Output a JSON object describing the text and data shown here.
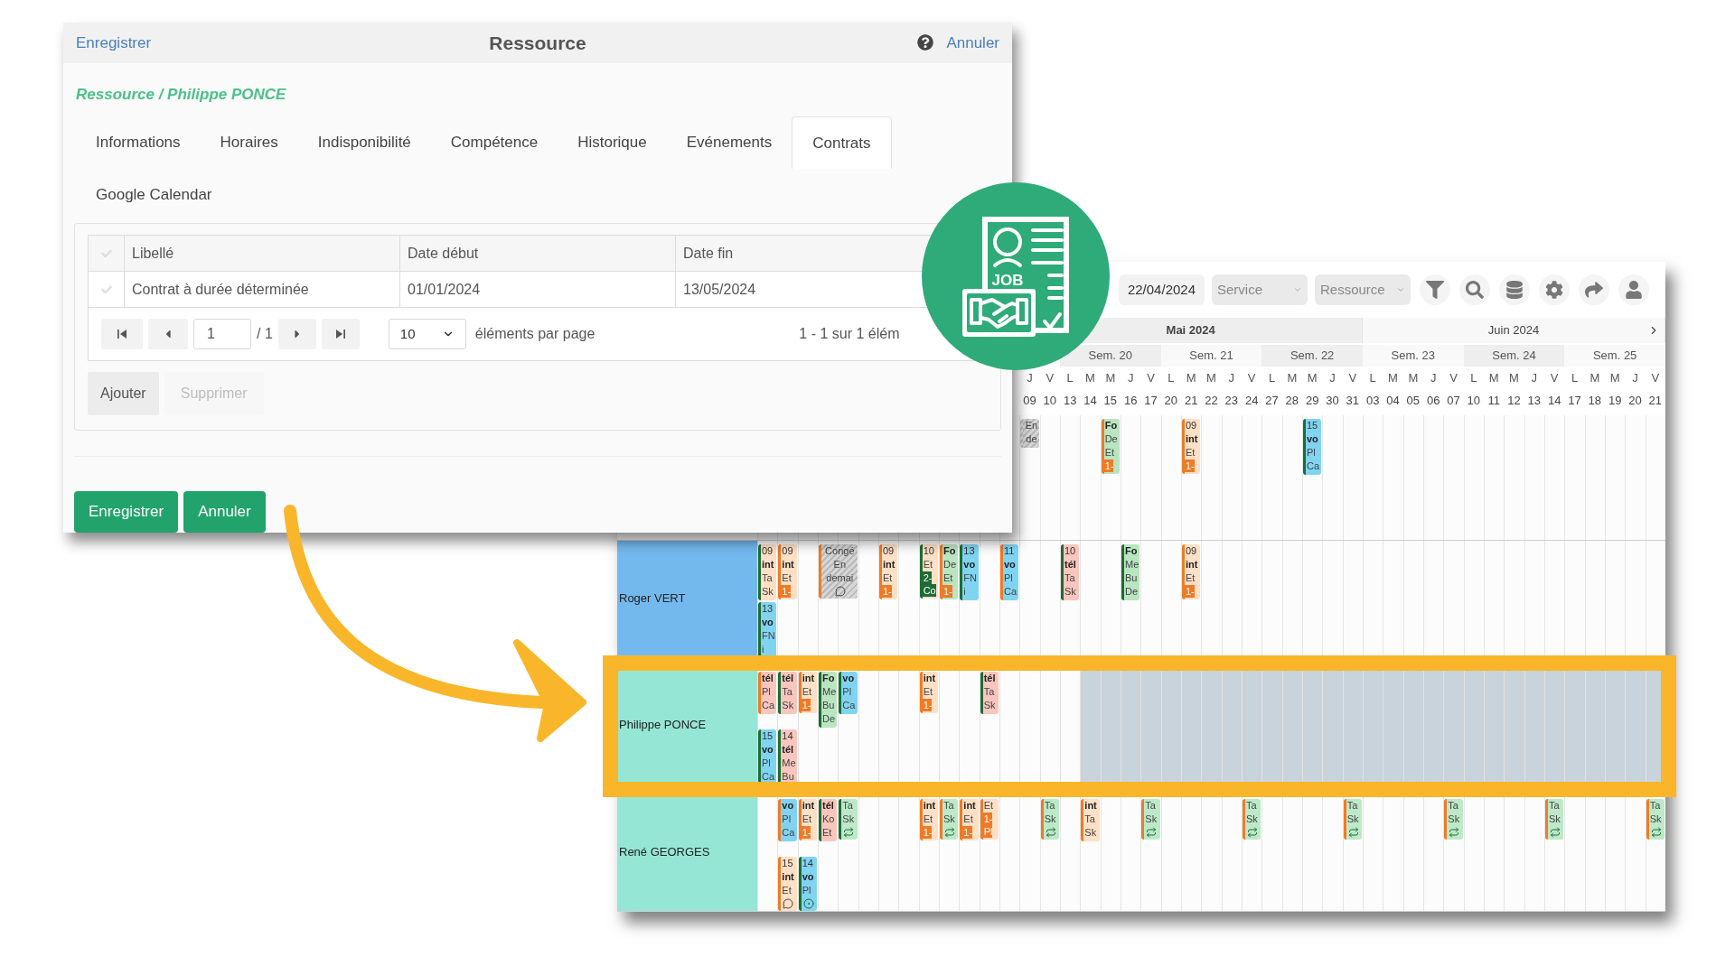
{
  "dialog": {
    "header_save": "Enregistrer",
    "title": "Ressource",
    "header_cancel": "Annuler",
    "breadcrumb": "Ressource / Philippe PONCE",
    "tabs": [
      {
        "label": "Informations",
        "selected": false
      },
      {
        "label": "Horaires",
        "selected": false
      },
      {
        "label": "Indisponibilité",
        "selected": false
      },
      {
        "label": "Compétence",
        "selected": false
      },
      {
        "label": "Historique",
        "selected": false
      },
      {
        "label": "Evénements",
        "selected": false
      },
      {
        "label": "Contrats",
        "selected": true
      },
      {
        "label": "Google Calendar",
        "selected": false
      }
    ],
    "table": {
      "columns": [
        "Libellé",
        "Date début",
        "Date fin"
      ],
      "rows": [
        [
          "Contrat à durée déterminée",
          "01/01/2024",
          "13/05/2024"
        ]
      ]
    },
    "pager": {
      "page": "1",
      "of": "/ 1",
      "per_page": "10",
      "per_page_label": "éléments par page",
      "summary": "1 - 1 sur 1 élém"
    },
    "actions": [
      {
        "label": "Ajouter",
        "disabled": false
      },
      {
        "label": "Supprimer",
        "disabled": true
      }
    ],
    "footer_buttons": [
      "Enregistrer",
      "Annuler"
    ]
  },
  "badge": {
    "label": "JOB"
  },
  "scheduler": {
    "date": "22/04/2024",
    "filters": [
      {
        "placeholder": "Service"
      },
      {
        "placeholder": "Ressource"
      }
    ],
    "months": [
      {
        "label": "Mai 2024",
        "weeks": [
          {
            "days": [
              {
                "letter": "J",
                "number": "09"
              },
              {
                "letter": "V",
                "number": "10"
              }
            ]
          },
          {
            "label": "Sem. 20",
            "days": [
              {
                "letter": "L",
                "number": "13"
              },
              {
                "letter": "M",
                "number": "14"
              },
              {
                "letter": "M",
                "number": "15"
              },
              {
                "letter": "J",
                "number": "16"
              },
              {
                "letter": "V",
                "number": "17"
              }
            ]
          },
          {
            "label": "Sem. 21",
            "days": [
              {
                "letter": "L",
                "number": "20"
              },
              {
                "letter": "M",
                "number": "21"
              },
              {
                "letter": "M",
                "number": "22"
              },
              {
                "letter": "J",
                "number": "23"
              },
              {
                "letter": "V",
                "number": "24"
              }
            ]
          },
          {
            "label": "Sem. 22",
            "days": [
              {
                "letter": "L",
                "number": "27"
              },
              {
                "letter": "M",
                "number": "28"
              },
              {
                "letter": "M",
                "number": "29"
              },
              {
                "letter": "J",
                "number": "30"
              },
              {
                "letter": "V",
                "number": "31"
              }
            ]
          }
        ]
      },
      {
        "label": "Juin 2024",
        "weeks": [
          {
            "label": "Sem. 23",
            "days": [
              {
                "letter": "L",
                "number": "03"
              },
              {
                "letter": "M",
                "number": "04"
              },
              {
                "letter": "M",
                "number": "05"
              },
              {
                "letter": "J",
                "number": "06"
              },
              {
                "letter": "V",
                "number": "07"
              }
            ]
          },
          {
            "label": "Sem. 24",
            "days": [
              {
                "letter": "L",
                "number": "10"
              },
              {
                "letter": "M",
                "number": "11"
              },
              {
                "letter": "M",
                "number": "12"
              },
              {
                "letter": "J",
                "number": "13"
              },
              {
                "letter": "V",
                "number": "14"
              }
            ]
          },
          {
            "label": "Sem. 25",
            "days": [
              {
                "letter": "L",
                "number": "17"
              },
              {
                "letter": "M",
                "number": "18"
              },
              {
                "letter": "M",
                "number": "19"
              },
              {
                "letter": "J",
                "number": "20"
              },
              {
                "letter": "V",
                "number": "21"
              }
            ]
          }
        ]
      }
    ],
    "rows": [
      {
        "highlighted": false,
        "cells": [
          null,
          null,
          null,
          null,
          null,
          null,
          null,
          null,
          null,
          null,
          null,
          null,
          null,
          [
            {
              "kind": "leave",
              "lines": [
                "En",
                "de"
              ]
            }
          ],
          null,
          null,
          null,
          [
            {
              "kind": "formation",
              "color": "#f07a26",
              "title": "Fo",
              "lines": [
                "De",
                "Et"
              ],
              "tags": [
                "1-"
              ]
            }
          ],
          null,
          null,
          null,
          [
            {
              "kind": "intervention",
              "color": "#f07a26",
              "time": "09",
              "title": "int",
              "lines": [
                "Et"
              ],
              "tags": [
                "1-"
              ]
            }
          ],
          null,
          null,
          null,
          null,
          null,
          [
            {
              "kind": "visio",
              "color": "#1f6b35",
              "time": "15",
              "title": "vo",
              "lines": [
                "Pl",
                "Ca"
              ]
            }
          ],
          null,
          null,
          null,
          null,
          null,
          null,
          null,
          null,
          null,
          null,
          null,
          null,
          null,
          null,
          null,
          null,
          null
        ]
      },
      {
        "name": "Roger VERT",
        "color": "#74b9ee",
        "highlighted": false,
        "cells": [
          [
            {
              "kind": "intervention",
              "color": "#1f6b35",
              "time": "09",
              "title": "int",
              "lines": [
                "Ta",
                "Sk"
              ]
            },
            {
              "kind": "visio",
              "color": "#1f6b35",
              "time": "13",
              "title": "vo",
              "lines": [
                "FN",
                "i"
              ]
            }
          ],
          [
            {
              "kind": "intervention",
              "color": "#f07a26",
              "time": "09",
              "title": "int",
              "lines": [
                "Et"
              ],
              "tags": [
                "1-"
              ]
            }
          ],
          null,
          [
            {
              "kind": "leave-note",
              "color": "#f07a26",
              "lines": [
                "Congé",
                "En",
                "demai"
              ]
            }
          ],
          null,
          null,
          [
            {
              "kind": "intervention",
              "color": "#f07a26",
              "time": "09",
              "title": "int",
              "lines": [
                "Et"
              ],
              "tags": [
                "1-"
              ]
            }
          ],
          null,
          [
            {
              "kind": "intervention-confirmed",
              "color": "#1f6b35",
              "time": "10",
              "lines": [
                "Et"
              ],
              "tags": [
                "2-",
                "Co"
              ]
            }
          ],
          [
            {
              "kind": "formation",
              "color": "#f07a26",
              "title": "Fo",
              "lines": [
                "De",
                "Et"
              ],
              "tags": [
                "1-"
              ]
            }
          ],
          [
            {
              "kind": "visio",
              "color": "#1f6b35",
              "time": "13",
              "title": "vo",
              "lines": [
                "FN",
                "i"
              ]
            }
          ],
          null,
          [
            {
              "kind": "visio",
              "color": "#f07a26",
              "time": "11",
              "title": "vo",
              "lines": [
                "Pl",
                "Ca"
              ]
            }
          ],
          null,
          null,
          [
            {
              "kind": "tel",
              "color": "#1f6b35",
              "time": "10",
              "title": "tél",
              "lines": [
                "Ta",
                "Sk"
              ]
            }
          ],
          null,
          null,
          [
            {
              "kind": "formation",
              "color": "#1f6b35",
              "title": "Fo",
              "lines": [
                "Me",
                "Bu",
                "De"
              ]
            }
          ],
          null,
          null,
          [
            {
              "kind": "intervention",
              "color": "#f07a26",
              "time": "09",
              "title": "int",
              "lines": [
                "Et"
              ],
              "tags": [
                "1-"
              ]
            }
          ],
          null,
          null,
          null,
          null,
          null,
          null,
          null,
          null,
          null,
          null,
          null,
          null,
          null,
          null,
          null,
          null,
          null,
          null,
          null,
          null,
          null,
          null,
          null
        ]
      },
      {
        "name": "Philippe PONCE",
        "color": "#95e6d5",
        "highlighted": true,
        "available": [
          true,
          true,
          true,
          true,
          true,
          true,
          true,
          true,
          true,
          true,
          true,
          true,
          true,
          true,
          true,
          true,
          false,
          false,
          false,
          false,
          false,
          false,
          false,
          false,
          false,
          false,
          false,
          false,
          false,
          false,
          false,
          false,
          false,
          false,
          false,
          false,
          false,
          false,
          false,
          false,
          false,
          false,
          false,
          false,
          false
        ],
        "cells": [
          [
            {
              "kind": "tel",
              "color": "#f07a26",
              "title": "tél",
              "lines": [
                "Pl",
                "Ca"
              ]
            },
            {
              "kind": "visio",
              "color": "#1f6b35",
              "time": "15",
              "title": "vo",
              "lines": [
                "Pl",
                "Ca"
              ]
            }
          ],
          [
            {
              "kind": "tel",
              "color": "#1f6b35",
              "title": "tél",
              "lines": [
                "Ta",
                "Sk"
              ]
            },
            {
              "kind": "tel",
              "color": "#1f6b35",
              "time": "14",
              "title": "tél",
              "lines": [
                "Me",
                "Bu"
              ]
            }
          ],
          [
            {
              "kind": "intervention",
              "color": "#f07a26",
              "title": "int",
              "lines": [
                "Et"
              ],
              "tags": [
                "1-"
              ]
            }
          ],
          [
            {
              "kind": "formation",
              "color": "#1f6b35",
              "title": "Fo",
              "lines": [
                "Me",
                "Bu",
                "De"
              ]
            }
          ],
          [
            {
              "kind": "visio",
              "color": "#1f6b35",
              "title": "vo",
              "lines": [
                "Pl",
                "Ca"
              ]
            }
          ],
          null,
          null,
          null,
          [
            {
              "kind": "intervention",
              "color": "#f07a26",
              "title": "int",
              "lines": [
                "Et"
              ],
              "tags": [
                "1-"
              ]
            }
          ],
          null,
          null,
          [
            {
              "kind": "tel",
              "color": "#1f6b35",
              "title": "tél",
              "lines": [
                "Ta",
                "Sk"
              ]
            }
          ],
          null,
          null,
          null,
          null,
          null,
          null,
          null,
          null,
          null,
          null,
          null,
          null,
          null,
          null,
          null,
          null,
          null,
          null,
          null,
          null,
          null,
          null,
          null,
          null,
          null,
          null,
          null,
          null,
          null,
          null,
          null,
          null,
          null
        ]
      },
      {
        "name": "René GEORGES",
        "color": "#95e6d5",
        "highlighted": false,
        "cells": [
          null,
          [
            {
              "kind": "visio",
              "color": "#f07a26",
              "title": "vo",
              "lines": [
                "Pl",
                "Ca"
              ]
            },
            {
              "kind": "intervention-note",
              "color": "#f07a26",
              "time": "15",
              "title": "int",
              "lines": [
                "Et"
              ]
            }
          ],
          [
            {
              "kind": "intervention",
              "color": "#f07a26",
              "title": "int",
              "lines": [
                "Et"
              ],
              "tags": [
                "1-"
              ]
            },
            {
              "kind": "visio-pin",
              "color": "#1f6b35",
              "time": "14",
              "title": "vo",
              "lines": [
                "Pl"
              ]
            }
          ],
          [
            {
              "kind": "tel",
              "color": "#1f6b35",
              "title": "tél",
              "lines": [
                "Ko",
                "Et"
              ]
            }
          ],
          [
            {
              "kind": "task",
              "color": "#1f6b35",
              "lines": [
                "Ta",
                "Sk"
              ]
            }
          ],
          null,
          null,
          null,
          [
            {
              "kind": "intervention",
              "color": "#f07a26",
              "title": "int",
              "lines": [
                "Et"
              ],
              "tags": [
                "1-"
              ]
            }
          ],
          [
            {
              "kind": "task",
              "color": "#f07a26",
              "lines": [
                "Ta",
                "Sk"
              ]
            }
          ],
          [
            {
              "kind": "intervention",
              "color": "#f07a26",
              "title": "int",
              "lines": [
                "Et"
              ],
              "tags": [
                "1-"
              ]
            }
          ],
          [
            {
              "kind": "intervention",
              "color": "#f07a26",
              "lines": [
                "Et"
              ],
              "tags": [
                "1-",
                "Pl"
              ]
            }
          ],
          null,
          null,
          [
            {
              "kind": "task",
              "color": "#f07a26",
              "lines": [
                "Ta",
                "Sk"
              ]
            }
          ],
          null,
          [
            {
              "kind": "intervention",
              "color": "#f07a26",
              "title": "int",
              "lines": [
                "Ta",
                "Sk"
              ]
            }
          ],
          null,
          null,
          [
            {
              "kind": "task",
              "color": "#f07a26",
              "lines": [
                "Ta",
                "Sk"
              ]
            }
          ],
          null,
          null,
          null,
          null,
          [
            {
              "kind": "task",
              "color": "#f07a26",
              "lines": [
                "Ta",
                "Sk"
              ]
            }
          ],
          null,
          null,
          null,
          null,
          [
            {
              "kind": "task",
              "color": "#f07a26",
              "lines": [
                "Ta",
                "Sk"
              ]
            }
          ],
          null,
          null,
          null,
          null,
          [
            {
              "kind": "task",
              "color": "#f07a26",
              "lines": [
                "Ta",
                "Sk"
              ]
            }
          ],
          null,
          null,
          null,
          null,
          [
            {
              "kind": "task",
              "color": "#f07a26",
              "lines": [
                "Ta",
                "Sk"
              ]
            }
          ],
          null,
          null,
          null,
          null,
          [
            {
              "kind": "task",
              "color": "#f07a26",
              "lines": [
                "Ta",
                "Sk"
              ]
            }
          ]
        ]
      }
    ]
  }
}
